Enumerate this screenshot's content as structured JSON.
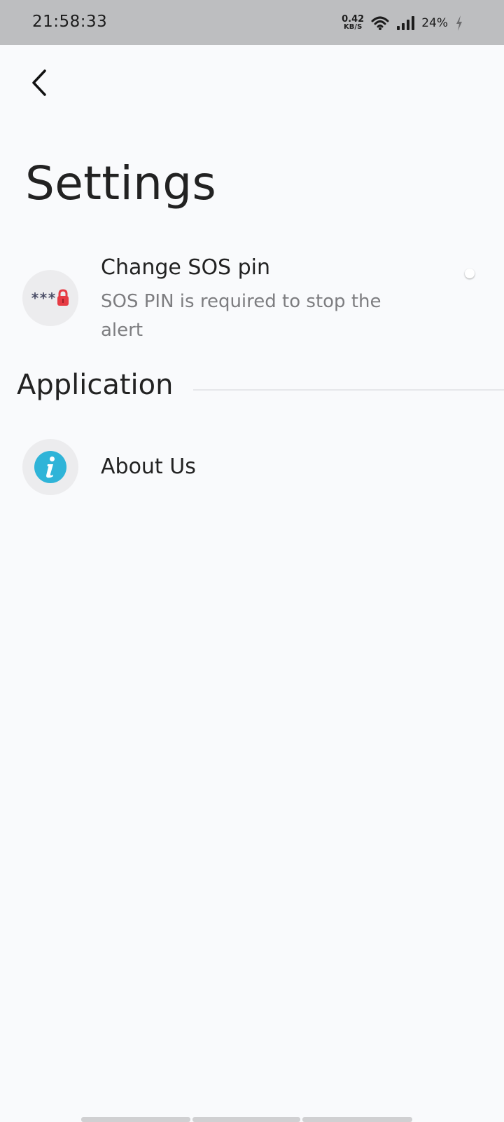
{
  "status_bar": {
    "time": "21:58:33",
    "net_speed_value": "0.42",
    "net_speed_unit": "KB/S",
    "battery": "24%",
    "icons": [
      "wifi-icon",
      "signal-icon",
      "charging-icon"
    ]
  },
  "header": {
    "back_icon": "back-arrow-icon",
    "title": "Settings"
  },
  "settings": {
    "items": [
      {
        "title": "Change SOS pin",
        "subtitle": "SOS PIN is required to stop the alert",
        "icon": "pin-lock-icon",
        "icon_text": "***"
      }
    ]
  },
  "sections": [
    {
      "title": "Application",
      "items": [
        {
          "title": "About Us",
          "icon": "info-icon"
        }
      ]
    }
  ],
  "colors": {
    "background": "#f9fafc",
    "status_bar": "#bdbec0",
    "icon_circle": "#ececee",
    "info_blue": "#2fb4d8",
    "lock_red": "#e63b44",
    "subtitle_gray": "#7d7d80"
  }
}
